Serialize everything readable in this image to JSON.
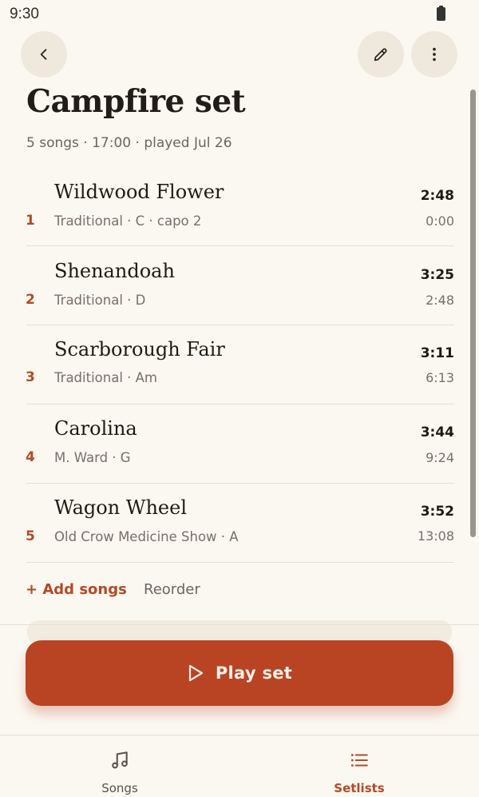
{
  "status": {
    "time": "9:30"
  },
  "header": {
    "back_icon": "chevron-left-icon",
    "edit_icon": "pencil-icon",
    "more_icon": "more-vertical-icon"
  },
  "setlist": {
    "title": "Campfire set",
    "meta": "5 songs · 17:00 · played Jul 26"
  },
  "songs": [
    {
      "number": "1",
      "title": "Wildwood Flower",
      "subtitle": "Traditional · C · capo 2",
      "duration": "2:48",
      "start": "0:00"
    },
    {
      "number": "2",
      "title": "Shenandoah",
      "subtitle": "Traditional · D",
      "duration": "3:25",
      "start": "2:48"
    },
    {
      "number": "3",
      "title": "Scarborough Fair",
      "subtitle": "Traditional · Am",
      "duration": "3:11",
      "start": "6:13"
    },
    {
      "number": "4",
      "title": "Carolina",
      "subtitle": "M. Ward · G",
      "duration": "3:44",
      "start": "9:24"
    },
    {
      "number": "5",
      "title": "Wagon Wheel",
      "subtitle": "Old Crow Medicine Show · A",
      "duration": "3:52",
      "start": "13:08"
    }
  ],
  "actions": {
    "add_songs": "+ Add songs",
    "reorder": "Reorder"
  },
  "play": {
    "label": "Play set",
    "icon": "play-icon"
  },
  "nav": {
    "songs_label": "Songs",
    "songs_icon": "music-note-icon",
    "setlists_label": "Setlists",
    "setlists_icon": "list-icon"
  },
  "colors": {
    "accent": "#b84423",
    "background": "#fbf8f1"
  }
}
